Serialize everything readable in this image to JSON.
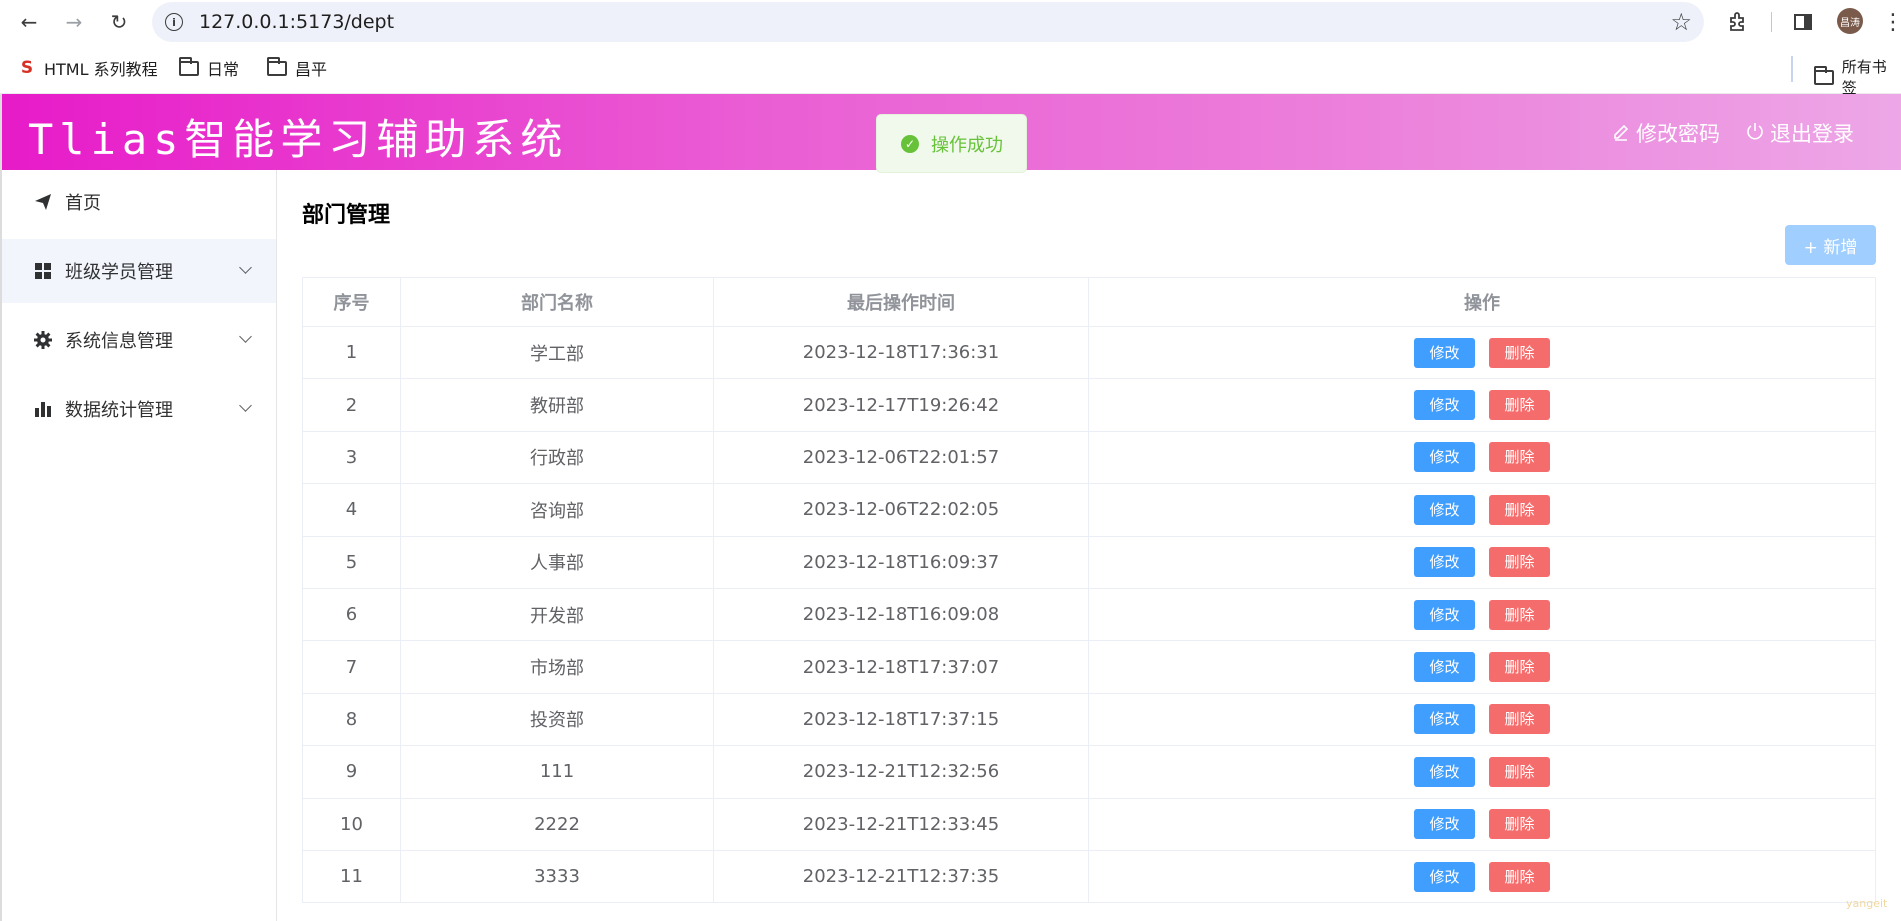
{
  "browser": {
    "url": "127.0.0.1:5173/dept",
    "avatar_text": "昌涛",
    "bookmarks": [
      {
        "label": "HTML 系列教程",
        "icon": "brand-icon"
      },
      {
        "label": "日常",
        "icon": "folder-icon"
      },
      {
        "label": "昌平",
        "icon": "folder-icon"
      }
    ],
    "all_bookmarks_label": "所有书签"
  },
  "header": {
    "title": "Tlias智能学习辅助系统",
    "change_password": "修改密码",
    "logout": "退出登录"
  },
  "toast": {
    "message": "操作成功"
  },
  "sidebar": {
    "items": [
      {
        "label": "首页",
        "icon": "send-icon"
      },
      {
        "label": "班级学员管理",
        "icon": "grid-icon"
      },
      {
        "label": "系统信息管理",
        "icon": "gear-icon"
      },
      {
        "label": "数据统计管理",
        "icon": "bar-chart-icon"
      }
    ]
  },
  "main": {
    "page_title": "部门管理",
    "add_button": "+ 新增",
    "columns": [
      "序号",
      "部门名称",
      "最后操作时间",
      "操作"
    ],
    "edit_label": "修改",
    "delete_label": "删除",
    "rows": [
      {
        "id": "1",
        "name": "学工部",
        "time": "2023-12-18T17:36:31"
      },
      {
        "id": "2",
        "name": "教研部",
        "time": "2023-12-17T19:26:42"
      },
      {
        "id": "3",
        "name": "行政部",
        "time": "2023-12-06T22:01:57"
      },
      {
        "id": "4",
        "name": "咨询部",
        "time": "2023-12-06T22:02:05"
      },
      {
        "id": "5",
        "name": "人事部",
        "time": "2023-12-18T16:09:37"
      },
      {
        "id": "6",
        "name": "开发部",
        "time": "2023-12-18T16:09:08"
      },
      {
        "id": "7",
        "name": "市场部",
        "time": "2023-12-18T17:37:07"
      },
      {
        "id": "8",
        "name": "投资部",
        "time": "2023-12-18T17:37:15"
      },
      {
        "id": "9",
        "name": "111",
        "time": "2023-12-21T12:32:56"
      },
      {
        "id": "10",
        "name": "2222",
        "time": "2023-12-21T12:33:45"
      },
      {
        "id": "11",
        "name": "3333",
        "time": "2023-12-21T12:37:35"
      }
    ]
  },
  "watermark": "yangeit"
}
